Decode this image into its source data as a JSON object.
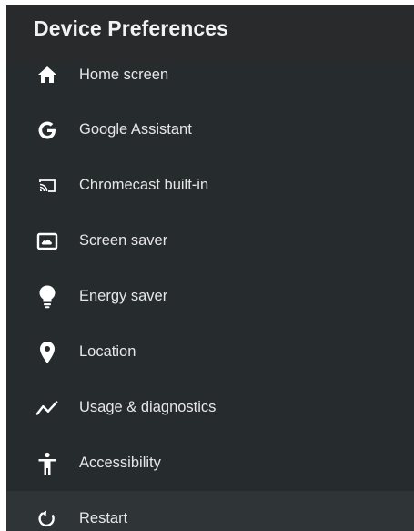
{
  "header": {
    "title": "Device Preferences"
  },
  "menu": {
    "items": [
      {
        "label": "Home screen",
        "icon": "home-icon"
      },
      {
        "label": "Google Assistant",
        "icon": "google-g-icon"
      },
      {
        "label": "Chromecast built-in",
        "icon": "cast-icon"
      },
      {
        "label": "Screen saver",
        "icon": "screen-saver-icon"
      },
      {
        "label": "Energy saver",
        "icon": "lightbulb-icon"
      },
      {
        "label": "Location",
        "icon": "location-pin-icon"
      },
      {
        "label": "Usage & diagnostics",
        "icon": "usage-chart-icon"
      },
      {
        "label": "Accessibility",
        "icon": "accessibility-icon"
      },
      {
        "label": "Restart",
        "icon": "restart-icon"
      }
    ]
  },
  "colors": {
    "background": "#262b2e",
    "header_background": "#292a2b",
    "focused_row": "#2f3437",
    "text": "#e6e6e6",
    "title": "#f2f2f2"
  }
}
